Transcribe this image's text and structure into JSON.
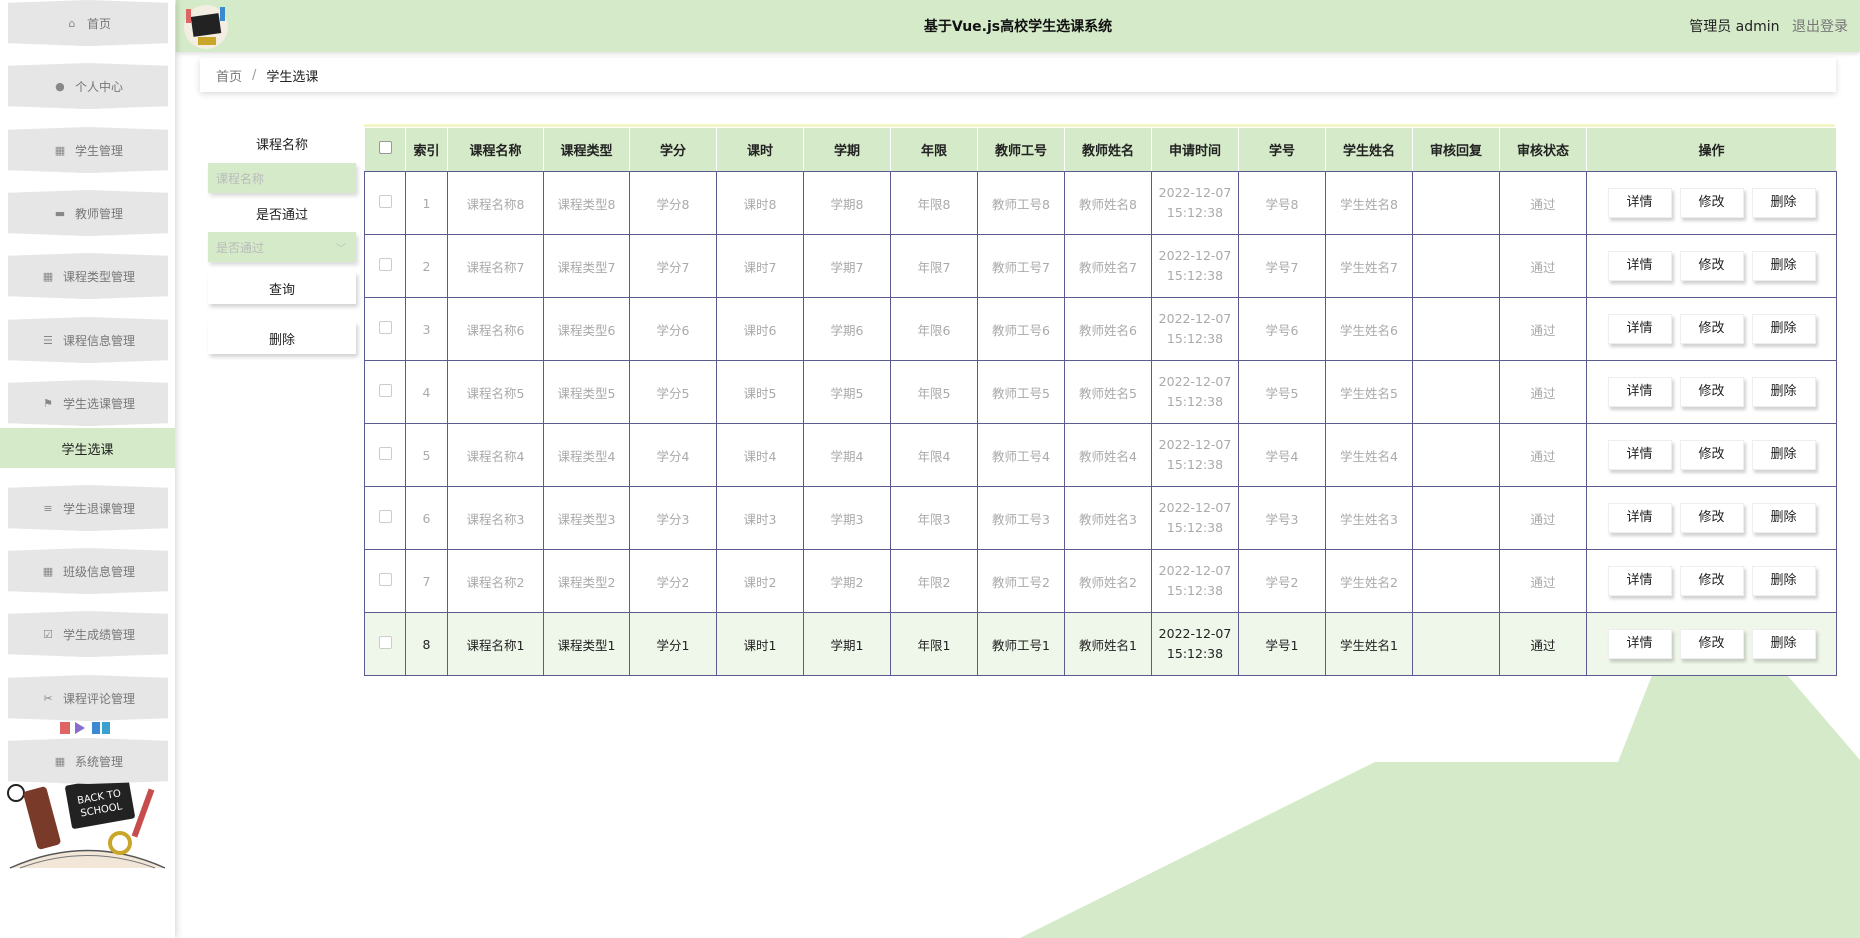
{
  "header": {
    "title": "基于Vue.js高校学生选课系统",
    "user_role": "管理员",
    "username": "admin",
    "logout": "退出登录"
  },
  "colors": {
    "accent": "#d4eac8",
    "table_border": "#5b5b8f",
    "row_highlight": "#eff7ea"
  },
  "sidebar": {
    "items": [
      {
        "label": "首页",
        "icon": "home-icon"
      },
      {
        "label": "个人中心",
        "icon": "user-icon"
      },
      {
        "label": "学生管理",
        "icon": "grid-icon"
      },
      {
        "label": "教师管理",
        "icon": "printer-icon"
      },
      {
        "label": "课程类型管理",
        "icon": "grid-icon"
      },
      {
        "label": "课程信息管理",
        "icon": "list-icon"
      },
      {
        "label": "学生选课管理",
        "icon": "flag-icon"
      },
      {
        "label": "学生退课管理",
        "icon": "sliders-icon"
      },
      {
        "label": "班级信息管理",
        "icon": "grid-icon"
      },
      {
        "label": "学生成绩管理",
        "icon": "checkbox-icon"
      },
      {
        "label": "课程评论管理",
        "icon": "ticket-icon"
      },
      {
        "label": "系统管理",
        "icon": "grid-icon"
      }
    ],
    "active_sub": "学生选课",
    "art_text": "BACK TO SCHOOL"
  },
  "breadcrumb": {
    "home": "首页",
    "sep": "/",
    "current": "学生选课"
  },
  "filter": {
    "course_name_label": "课程名称",
    "course_name_placeholder": "课程名称",
    "passed_label": "是否通过",
    "passed_placeholder": "是否通过",
    "search_button": "查询",
    "delete_button": "删除"
  },
  "table": {
    "headers": [
      "索引",
      "课程名称",
      "课程类型",
      "学分",
      "课时",
      "学期",
      "年限",
      "教师工号",
      "教师姓名",
      "申请时间",
      "学号",
      "学生姓名",
      "审核回复",
      "审核状态",
      "操作"
    ],
    "rows": [
      {
        "idx": "1",
        "name": "课程名称8",
        "type": "课程类型8",
        "credit": "学分8",
        "hours": "课时8",
        "term": "学期8",
        "years": "年限8",
        "tno": "教师工号8",
        "tname": "教师姓名8",
        "date": "2022-12-07",
        "time": "15:12:38",
        "sno": "学号8",
        "sname": "学生姓名8",
        "reply": "",
        "status": "通过"
      },
      {
        "idx": "2",
        "name": "课程名称7",
        "type": "课程类型7",
        "credit": "学分7",
        "hours": "课时7",
        "term": "学期7",
        "years": "年限7",
        "tno": "教师工号7",
        "tname": "教师姓名7",
        "date": "2022-12-07",
        "time": "15:12:38",
        "sno": "学号7",
        "sname": "学生姓名7",
        "reply": "",
        "status": "通过"
      },
      {
        "idx": "3",
        "name": "课程名称6",
        "type": "课程类型6",
        "credit": "学分6",
        "hours": "课时6",
        "term": "学期6",
        "years": "年限6",
        "tno": "教师工号6",
        "tname": "教师姓名6",
        "date": "2022-12-07",
        "time": "15:12:38",
        "sno": "学号6",
        "sname": "学生姓名6",
        "reply": "",
        "status": "通过"
      },
      {
        "idx": "4",
        "name": "课程名称5",
        "type": "课程类型5",
        "credit": "学分5",
        "hours": "课时5",
        "term": "学期5",
        "years": "年限5",
        "tno": "教师工号5",
        "tname": "教师姓名5",
        "date": "2022-12-07",
        "time": "15:12:38",
        "sno": "学号5",
        "sname": "学生姓名5",
        "reply": "",
        "status": "通过"
      },
      {
        "idx": "5",
        "name": "课程名称4",
        "type": "课程类型4",
        "credit": "学分4",
        "hours": "课时4",
        "term": "学期4",
        "years": "年限4",
        "tno": "教师工号4",
        "tname": "教师姓名4",
        "date": "2022-12-07",
        "time": "15:12:38",
        "sno": "学号4",
        "sname": "学生姓名4",
        "reply": "",
        "status": "通过"
      },
      {
        "idx": "6",
        "name": "课程名称3",
        "type": "课程类型3",
        "credit": "学分3",
        "hours": "课时3",
        "term": "学期3",
        "years": "年限3",
        "tno": "教师工号3",
        "tname": "教师姓名3",
        "date": "2022-12-07",
        "time": "15:12:38",
        "sno": "学号3",
        "sname": "学生姓名3",
        "reply": "",
        "status": "通过"
      },
      {
        "idx": "7",
        "name": "课程名称2",
        "type": "课程类型2",
        "credit": "学分2",
        "hours": "课时2",
        "term": "学期2",
        "years": "年限2",
        "tno": "教师工号2",
        "tname": "教师姓名2",
        "date": "2022-12-07",
        "time": "15:12:38",
        "sno": "学号2",
        "sname": "学生姓名2",
        "reply": "",
        "status": "通过"
      },
      {
        "idx": "8",
        "name": "课程名称1",
        "type": "课程类型1",
        "credit": "学分1",
        "hours": "课时1",
        "term": "学期1",
        "years": "年限1",
        "tno": "教师工号1",
        "tname": "教师姓名1",
        "date": "2022-12-07",
        "time": "15:12:38",
        "sno": "学号1",
        "sname": "学生姓名1",
        "reply": "",
        "status": "通过"
      }
    ],
    "actions": {
      "detail": "详情",
      "edit": "修改",
      "delete": "删除"
    }
  }
}
